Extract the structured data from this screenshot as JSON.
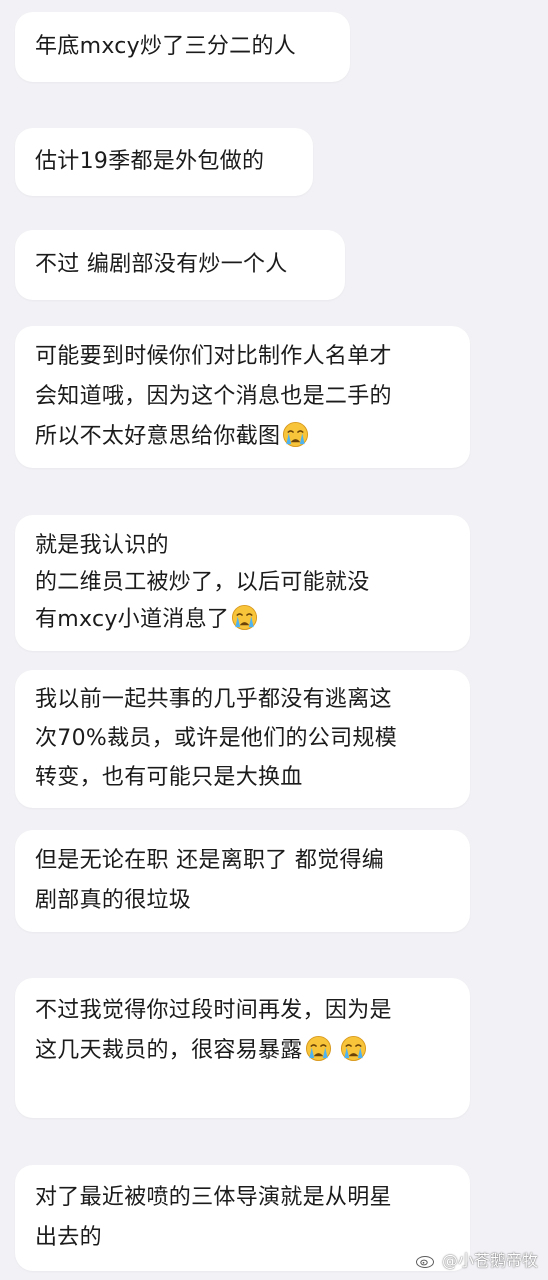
{
  "messages": [
    {
      "lines": [
        "年底mxcy炒了三分二的人"
      ],
      "emoji_count": 0
    },
    {
      "lines": [
        "估计19季都是外包做的"
      ],
      "emoji_count": 0
    },
    {
      "lines": [
        "不过 编剧部没有炒一个人"
      ],
      "emoji_count": 0
    },
    {
      "lines": [
        "可能要到时候你们对比制作人名单才",
        "会知道哦，因为这个消息也是二手的",
        "所以不太好意思给你截图"
      ],
      "emoji_count": 1
    },
    {
      "lines": [
        "就是我认识的",
        "的二维员工被炒了，以后可能就没",
        "有mxcy小道消息了"
      ],
      "emoji_count": 1
    },
    {
      "lines": [
        "我以前一起共事的几乎都没有逃离这",
        "次70%裁员，或许是他们的公司规模",
        "转变，也有可能只是大换血"
      ],
      "emoji_count": 0
    },
    {
      "lines": [
        "但是无论在职 还是离职了 都觉得编",
        "剧部真的很垃圾"
      ],
      "emoji_count": 0
    },
    {
      "lines": [
        "不过我觉得你过段时间再发，因为是",
        "这几天裁员的，很容易暴露"
      ],
      "emoji_count": 2
    },
    {
      "lines": [
        "对了最近被喷的三体导演就是从明星",
        "出去的"
      ],
      "emoji_count": 0
    }
  ],
  "emoji_icon": "crying-face-icon",
  "watermark": {
    "text": "@小苍鹅帝牧",
    "icon": "weibo-logo-icon"
  },
  "colors": {
    "background": "#f2f2f6",
    "bubble": "#ffffff",
    "text": "#1b1b1b",
    "emoji_face": "#f8c53a"
  }
}
